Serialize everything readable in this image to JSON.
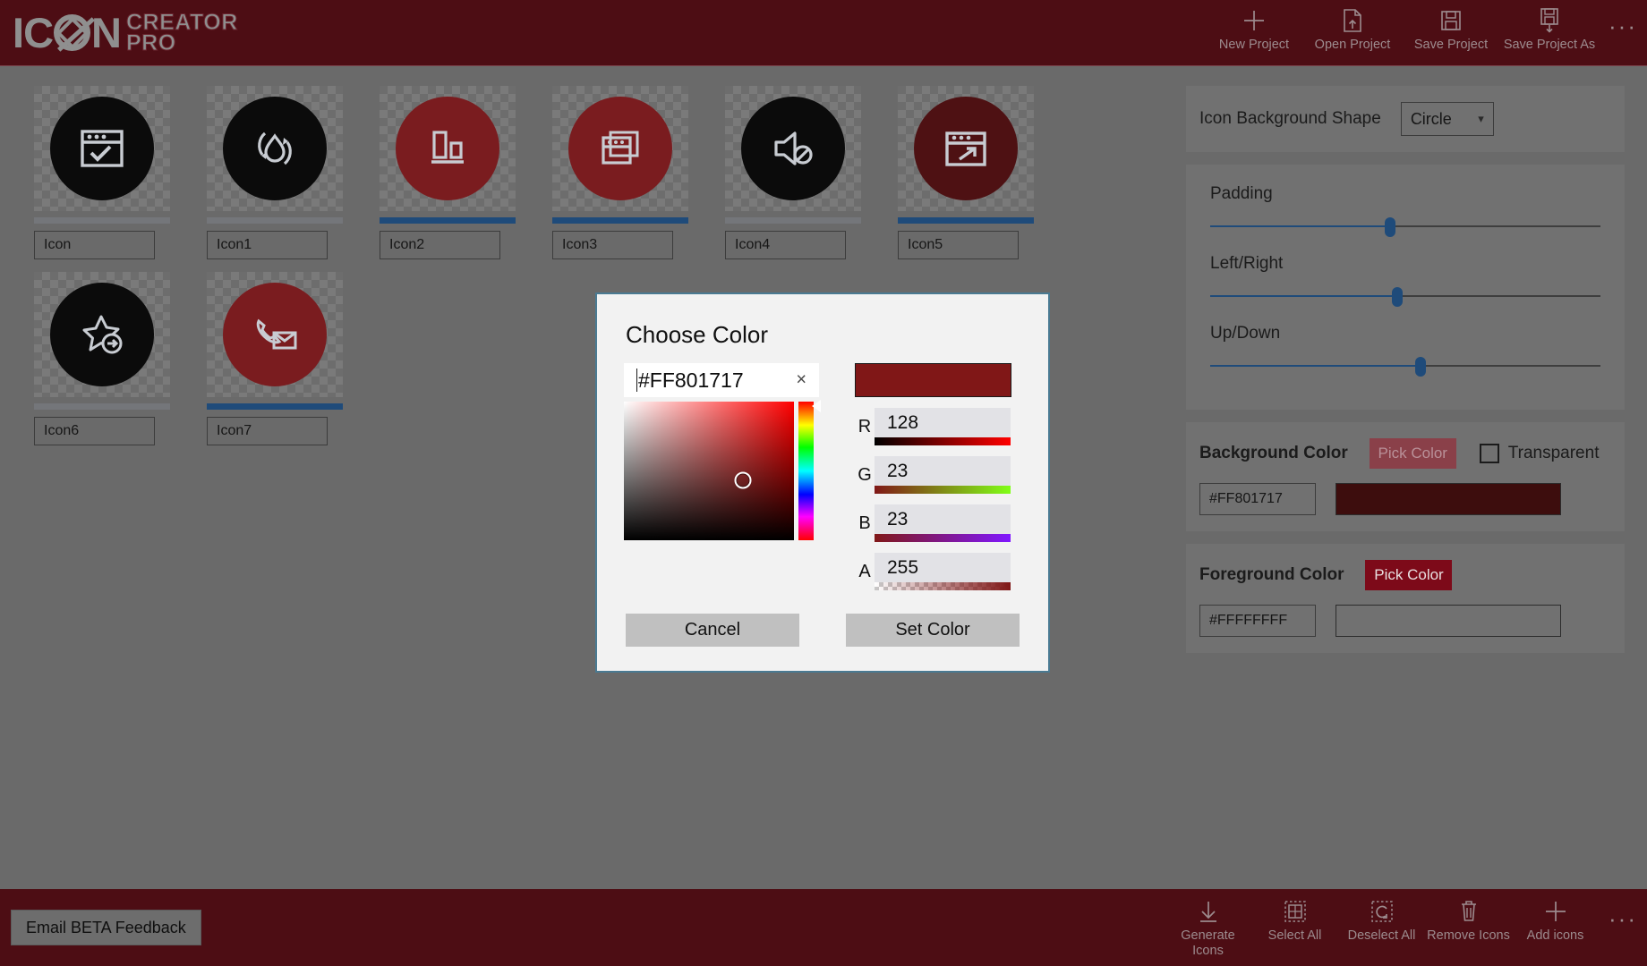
{
  "app": {
    "logo_main": "ICON",
    "logo_line1": "CREATOR",
    "logo_line2": "PRO"
  },
  "toolbar": {
    "items": [
      {
        "label": "New Project",
        "icon": "plus-icon"
      },
      {
        "label": "Open Project",
        "icon": "open-file-icon"
      },
      {
        "label": "Save Project",
        "icon": "save-icon"
      },
      {
        "label": "Save Project As",
        "icon": "save-as-icon"
      }
    ],
    "overflow": "···"
  },
  "icons": [
    {
      "name": "Icon",
      "selected": false,
      "glyph": "window-check-icon"
    },
    {
      "name": "Icon1",
      "selected": false,
      "glyph": "water-recycle-icon"
    },
    {
      "name": "Icon2",
      "selected": true,
      "glyph": "align-bottom-icon"
    },
    {
      "name": "Icon3",
      "selected": true,
      "glyph": "windows-stack-icon"
    },
    {
      "name": "Icon4",
      "selected": false,
      "glyph": "speaker-mute-icon"
    },
    {
      "name": "Icon5",
      "selected": true,
      "glyph": "window-external-link-icon"
    },
    {
      "name": "Icon6",
      "selected": false,
      "glyph": "star-arrow-icon"
    },
    {
      "name": "Icon7",
      "selected": true,
      "glyph": "phone-mail-icon"
    }
  ],
  "sidebar": {
    "shape": {
      "label": "Icon Background Shape",
      "value": "Circle"
    },
    "sliders": [
      {
        "label": "Padding",
        "percent": 46
      },
      {
        "label": "Left/Right",
        "percent": 48
      },
      {
        "label": "Up/Down",
        "percent": 54
      }
    ],
    "background_color": {
      "label": "Background Color",
      "pick_label": "Pick Color",
      "transparent_label": "Transparent",
      "transparent_checked": false,
      "hex": "#FF801717",
      "swatch": "#3d0d0d",
      "button_enabled": false
    },
    "foreground_color": {
      "label": "Foreground Color",
      "pick_label": "Pick Color",
      "hex": "#FFFFFFFF",
      "swatch": "#6a6a6a",
      "button_enabled": true
    }
  },
  "dialog": {
    "title": "Choose Color",
    "hex_value": "#FF801717",
    "clear_glyph": "×",
    "preview_color": "#801717",
    "sv_marker": {
      "x_percent": 70,
      "y_percent": 57
    },
    "hue_percent": 0,
    "channels": [
      {
        "letter": "R",
        "value": "128",
        "grad": "grad-r"
      },
      {
        "letter": "G",
        "value": "23",
        "grad": "grad-g"
      },
      {
        "letter": "B",
        "value": "23",
        "grad": "grad-b"
      },
      {
        "letter": "A",
        "value": "255",
        "grad": "grad-a"
      }
    ],
    "cancel_label": "Cancel",
    "confirm_label": "Set Color"
  },
  "bottom": {
    "beta_label": "Email BETA Feedback",
    "items": [
      {
        "label": "Generate Icons",
        "icon": "download-icon"
      },
      {
        "label": "Select All",
        "icon": "select-all-icon"
      },
      {
        "label": "Deselect All",
        "icon": "deselect-all-icon"
      },
      {
        "label": "Remove Icons",
        "icon": "trash-icon"
      },
      {
        "label": "Add icons",
        "icon": "plus-icon"
      }
    ],
    "overflow": "···"
  },
  "colors": {
    "brand_dark_red": "#4d0d14",
    "accent_red": "#7d0a19",
    "selection_blue": "#1f4b7a",
    "icon_red": "#7a1c1f",
    "icon_black": "#0b0b0b",
    "dialog_border": "#4a7a92"
  }
}
